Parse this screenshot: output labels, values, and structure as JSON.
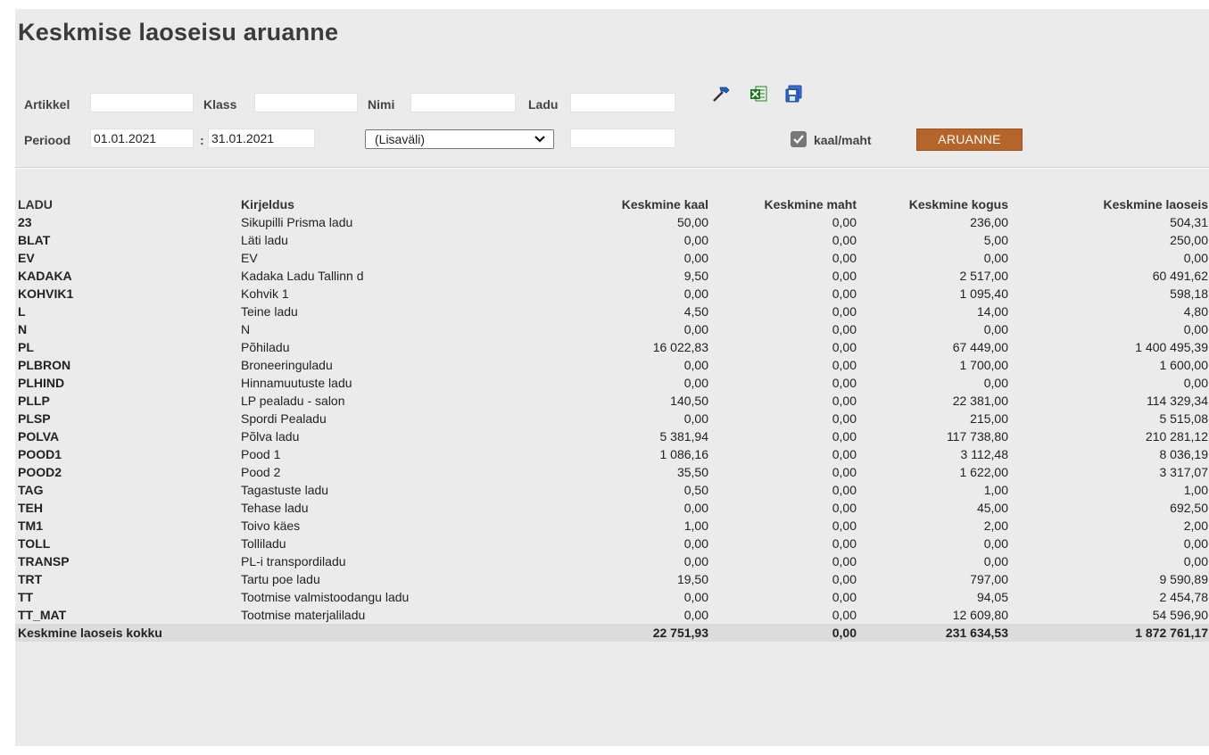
{
  "page": {
    "title": "Keskmise laoseisu aruanne"
  },
  "filters": {
    "artikkel_label": "Artikkel",
    "artikkel_value": "",
    "klass_label": "Klass",
    "klass_value": "",
    "nimi_label": "Nimi",
    "nimi_value": "",
    "ladu_label": "Ladu",
    "ladu_value": "",
    "periood_label": "Periood",
    "date_from": "01.01.2021",
    "date_sep": ":",
    "date_to": "31.01.2021",
    "lisavali_selected": "(Lisaväli)",
    "lisavali_value": "",
    "weight_volume_label": "kaal/maht",
    "weight_volume_checked": true,
    "report_button": "ARUANNE"
  },
  "toolbar_icons": [
    "settings-hammer-icon",
    "excel-export-icon",
    "save-icon"
  ],
  "table": {
    "headers": [
      "LADU",
      "Kirjeldus",
      "Keskmine kaal",
      "Keskmine maht",
      "Keskmine kogus",
      "Keskmine laoseis"
    ],
    "rows": [
      [
        "23",
        "Sikupilli Prisma ladu",
        "50,00",
        "0,00",
        "236,00",
        "504,31"
      ],
      [
        "BLAT",
        "Läti ladu",
        "0,00",
        "0,00",
        "5,00",
        "250,00"
      ],
      [
        "EV",
        "EV",
        "0,00",
        "0,00",
        "0,00",
        "0,00"
      ],
      [
        "KADAKA",
        "Kadaka Ladu Tallinn d",
        "9,50",
        "0,00",
        "2 517,00",
        "60 491,62"
      ],
      [
        "KOHVIK1",
        "Kohvik 1",
        "0,00",
        "0,00",
        "1 095,40",
        "598,18"
      ],
      [
        "L",
        "Teine ladu",
        "4,50",
        "0,00",
        "14,00",
        "4,80"
      ],
      [
        "N",
        "N",
        "0,00",
        "0,00",
        "0,00",
        "0,00"
      ],
      [
        "PL",
        "Põhiladu",
        "16 022,83",
        "0,00",
        "67 449,00",
        "1 400 495,39"
      ],
      [
        "PLBRON",
        "Broneeringuladu",
        "0,00",
        "0,00",
        "1 700,00",
        "1 600,00"
      ],
      [
        "PLHIND",
        "Hinnamuutuste ladu",
        "0,00",
        "0,00",
        "0,00",
        "0,00"
      ],
      [
        "PLLP",
        "LP pealadu - salon",
        "140,50",
        "0,00",
        "22 381,00",
        "114 329,34"
      ],
      [
        "PLSP",
        "Spordi Pealadu",
        "0,00",
        "0,00",
        "215,00",
        "5 515,08"
      ],
      [
        "POLVA",
        "Põlva ladu",
        "5 381,94",
        "0,00",
        "117 738,80",
        "210 281,12"
      ],
      [
        "POOD1",
        "Pood 1",
        "1 086,16",
        "0,00",
        "3 112,48",
        "8 036,19"
      ],
      [
        "POOD2",
        "Pood 2",
        "35,50",
        "0,00",
        "1 622,00",
        "3 317,07"
      ],
      [
        "TAG",
        "Tagastuste ladu",
        "0,50",
        "0,00",
        "1,00",
        "1,00"
      ],
      [
        "TEH",
        "Tehase ladu",
        "0,00",
        "0,00",
        "45,00",
        "692,50"
      ],
      [
        "TM1",
        "Toivo käes",
        "1,00",
        "0,00",
        "2,00",
        "2,00"
      ],
      [
        "TOLL",
        "Tolliladu",
        "0,00",
        "0,00",
        "0,00",
        "0,00"
      ],
      [
        "TRANSP",
        "PL-i transpordiladu",
        "0,00",
        "0,00",
        "0,00",
        "0,00"
      ],
      [
        "TRT",
        "Tartu poe ladu",
        "19,50",
        "0,00",
        "797,00",
        "9 590,89"
      ],
      [
        "TT",
        "Tootmise valmistoodangu ladu",
        "0,00",
        "0,00",
        "94,05",
        "2 454,78"
      ],
      [
        "TT_MAT",
        "Tootmise materjaliladu",
        "0,00",
        "0,00",
        "12 609,80",
        "54 596,90"
      ]
    ],
    "total": [
      "Keskmine laoseis kokku",
      "",
      "22 751,93",
      "0,00",
      "231 634,53",
      "1 872 761,17"
    ]
  },
  "colors": {
    "page_bg": "#ebebeb",
    "button_bg": "#b5642a",
    "total_row_bg": "#dcdcdc"
  }
}
